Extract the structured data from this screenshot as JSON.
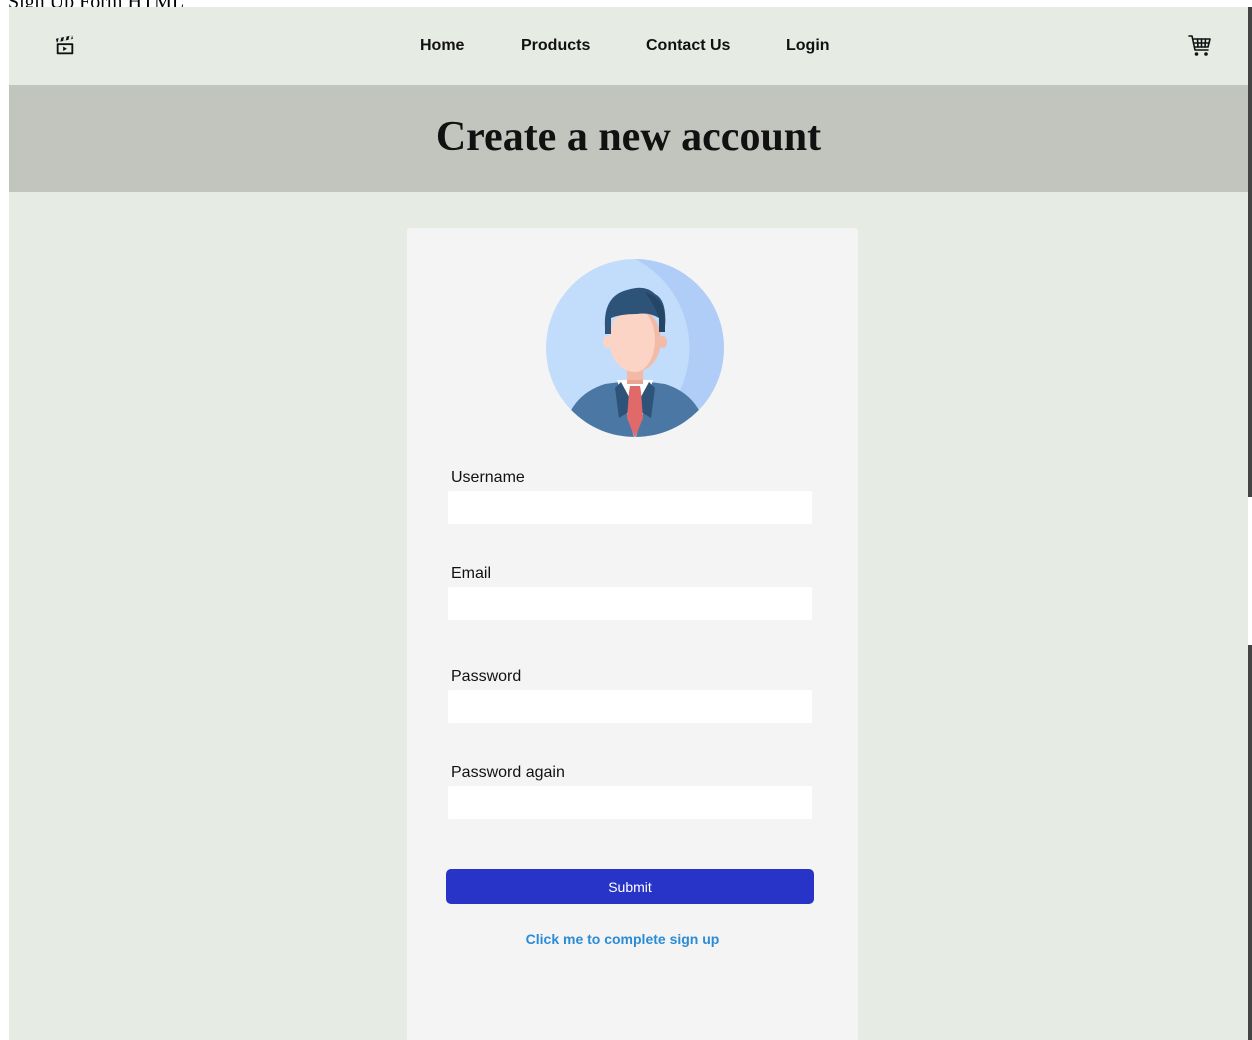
{
  "document": {
    "title": "Sign Up Form HTML"
  },
  "navbar": {
    "logo_icon": "clapperboard-icon",
    "links": [
      {
        "label": "Home"
      },
      {
        "label": "Products"
      },
      {
        "label": "Contact Us"
      },
      {
        "label": "Login"
      }
    ],
    "cart_icon": "shopping-cart-icon"
  },
  "hero": {
    "title": "Create a new account"
  },
  "form": {
    "avatar_icon": "user-avatar-icon",
    "fields": [
      {
        "label": "Username",
        "value": "",
        "placeholder": ""
      },
      {
        "label": "Email",
        "value": "",
        "placeholder": ""
      },
      {
        "label": "Password",
        "value": "",
        "placeholder": ""
      },
      {
        "label": "Password again",
        "value": "",
        "placeholder": ""
      }
    ],
    "submit_label": "Submit",
    "complete_link": "Click me to complete sign up"
  },
  "colors": {
    "page_bg": "#e6ebe4",
    "hero_bg": "#c2c5bd",
    "card_bg": "#f4f4f4",
    "submit_bg": "#2833c7",
    "link": "#2a8bd6"
  }
}
